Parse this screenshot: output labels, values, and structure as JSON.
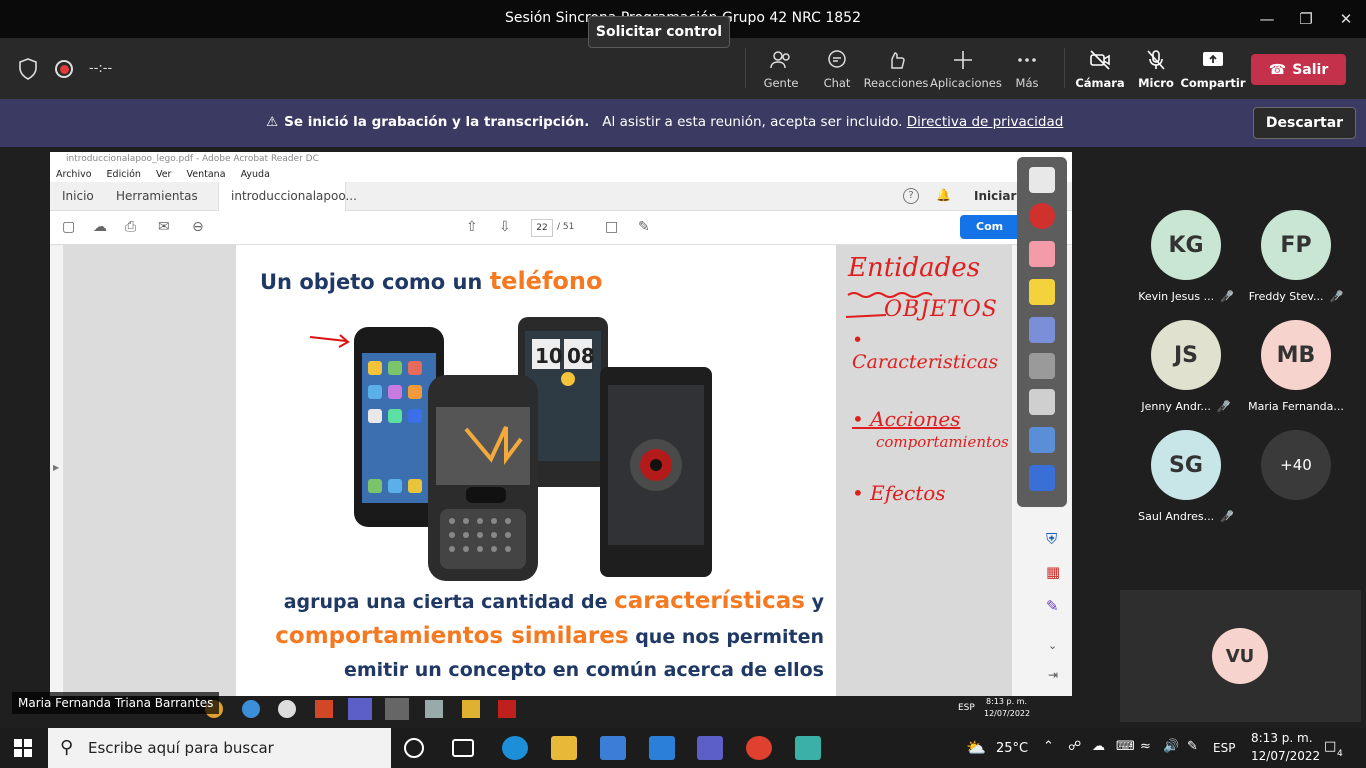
{
  "window": {
    "title": "Sesión Sincrona Programación Grupo 42 NRC 1852"
  },
  "meeting_bar": {
    "timer": "--:--",
    "request_control": "Solicitar control",
    "controls": [
      {
        "label": "Gente",
        "icon": "people-icon"
      },
      {
        "label": "Chat",
        "icon": "chat-icon"
      },
      {
        "label": "Reacciones",
        "icon": "reactions-icon"
      },
      {
        "label": "Aplicaciones",
        "icon": "add-icon"
      },
      {
        "label": "Más",
        "icon": "more-icon"
      },
      {
        "label": "Cámara",
        "icon": "camera-off-icon"
      },
      {
        "label": "Micro",
        "icon": "mic-off-icon"
      },
      {
        "label": "Compartir",
        "icon": "share-icon"
      }
    ],
    "leave": "Salir"
  },
  "banner": {
    "bold": "Se inició la grabación y la transcripción.",
    "text": "Al asistir a esta reunión, acepta ser incluido.",
    "link": "Directiva de privacidad",
    "dismiss": "Descartar"
  },
  "acrobat": {
    "title": "introduccionalapoo_lego.pdf - Adobe Acrobat Reader DC",
    "menu": [
      "Archivo",
      "Edición",
      "Ver",
      "Ventana",
      "Ayuda"
    ],
    "tabs": [
      "Inicio",
      "Herramientas",
      "introduccionalapoo..."
    ],
    "signin": "Iniciar sesió",
    "page": "22",
    "pages_total": "/ 51",
    "share": "Com"
  },
  "slide": {
    "title_pre": "Un objeto como un",
    "title_hl": "teléfono",
    "line1_pre": "agrupa una cierta cantidad de",
    "line1_hl": "características",
    "line1_post": "y",
    "line2_hl": "comportamientos similares",
    "line2_post": "que nos permiten",
    "line3": "emitir un concepto en común acerca de ellos"
  },
  "handwriting": {
    "l1": "Entidades",
    "l2": "OBJETOS",
    "l3": "• Caracteristicas",
    "l4": "• Acciones",
    "l5": "comportamientos",
    "l6": "• Efectos"
  },
  "participants": [
    {
      "initials": "KG",
      "name": "Kevin Jesus ...",
      "color": "#c8e6d3"
    },
    {
      "initials": "FP",
      "name": "Freddy Stev...",
      "color": "#c8e6d3"
    },
    {
      "initials": "JS",
      "name": "Jenny Andr...",
      "color": "#e1e1cf"
    },
    {
      "initials": "MB",
      "name": "Maria Fernanda...",
      "color": "#f6d3cc"
    },
    {
      "initials": "SG",
      "name": "Saul Andres...",
      "color": "#c8e6e8"
    },
    {
      "initials": "+40",
      "name": "",
      "color": "#3a3a3a"
    }
  ],
  "self": {
    "initials": "VU",
    "color": "#f6d3cc"
  },
  "speaker": "Maria Fernanda Triana Barrantes",
  "inner_taskbar": {
    "lang": "ESP",
    "time": "8:13 p. m.",
    "date": "12/07/2022"
  },
  "taskbar": {
    "search_placeholder": "Escribe aquí para buscar",
    "temp": "25°C",
    "lang": "ESP",
    "time": "8:13 p. m.",
    "date": "12/07/2022",
    "notifications": "4"
  }
}
